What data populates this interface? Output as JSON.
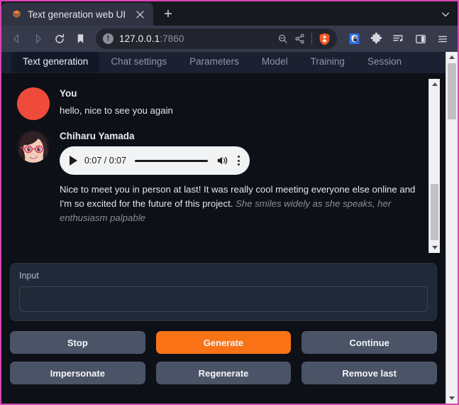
{
  "browser": {
    "tab": {
      "title": "Text generation web UI",
      "favicon_icon": "hexagon-layers-icon",
      "close_icon": "close-icon"
    },
    "new_tab_label": "+",
    "tab_list_chevron_icon": "chevron-down-icon",
    "nav": {
      "back_icon": "back-arrow-icon",
      "forward_icon": "forward-arrow-icon",
      "reload_icon": "reload-icon",
      "bookmark_icon": "bookmark-icon"
    },
    "url": {
      "info_icon": "info-circle-icon",
      "info_glyph": "!",
      "host": "127.0.0.1",
      "port": ":7860",
      "zoom_out_icon": "zoom-out-icon",
      "share_icon": "share-icon",
      "shields_icon": "brave-shields-lion-icon"
    },
    "extensions": {
      "password_manager_icon": "password-manager-icon",
      "puzzle_icon": "extensions-puzzle-icon",
      "playlist_icon": "playlist-icon",
      "sidebar_icon": "sidebar-toggle-icon",
      "menu_icon": "hamburger-menu-icon"
    }
  },
  "app": {
    "tabs": [
      {
        "label": "Text generation",
        "active": true
      },
      {
        "label": "Chat settings",
        "active": false
      },
      {
        "label": "Parameters",
        "active": false
      },
      {
        "label": "Model",
        "active": false
      },
      {
        "label": "Training",
        "active": false
      },
      {
        "label": "Session",
        "active": false
      }
    ],
    "chat": {
      "messages": [
        {
          "name": "You",
          "avatar": "user-avatar-red-circle",
          "text": "hello, nice to see you again",
          "emote": "",
          "has_audio": false
        },
        {
          "name": "Chiharu Yamada",
          "avatar": "character-avatar-anime-glasses",
          "text": "Nice to meet you in person at last! It was really cool meeting everyone else online and I'm so excited for the future of this project. ",
          "emote": "She smiles widely as she speaks, her enthusiasm palpable",
          "has_audio": true,
          "audio": {
            "play_icon": "play-icon",
            "time": "0:07 / 0:07",
            "volume_icon": "volume-icon",
            "menu_icon": "three-dots-vertical-icon"
          }
        }
      ]
    },
    "input": {
      "label": "Input",
      "value": "",
      "placeholder": ""
    },
    "buttons": [
      {
        "label": "Stop",
        "primary": false
      },
      {
        "label": "Generate",
        "primary": true
      },
      {
        "label": "Continue",
        "primary": false
      },
      {
        "label": "Impersonate",
        "primary": false
      },
      {
        "label": "Regenerate",
        "primary": false
      },
      {
        "label": "Remove last",
        "primary": false
      }
    ]
  },
  "colors": {
    "accent_orange": "#f97316",
    "window_border": "#d946b4",
    "page_bg": "#0d1117",
    "button_bg": "#4b5366",
    "user_avatar": "#ef4b3a"
  }
}
